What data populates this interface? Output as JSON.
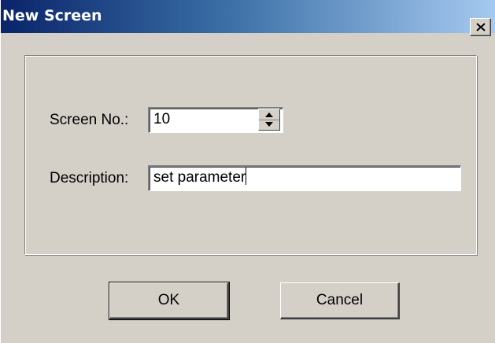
{
  "dialog": {
    "title": "New Screen",
    "close_icon": "close-icon"
  },
  "form": {
    "screen_no_label": "Screen No.:",
    "screen_no_value": "10",
    "spin_icon": "spin-arrows-icon",
    "description_label": "Description:",
    "description_value": "set parameter"
  },
  "buttons": {
    "ok_label": "OK",
    "cancel_label": "Cancel"
  }
}
